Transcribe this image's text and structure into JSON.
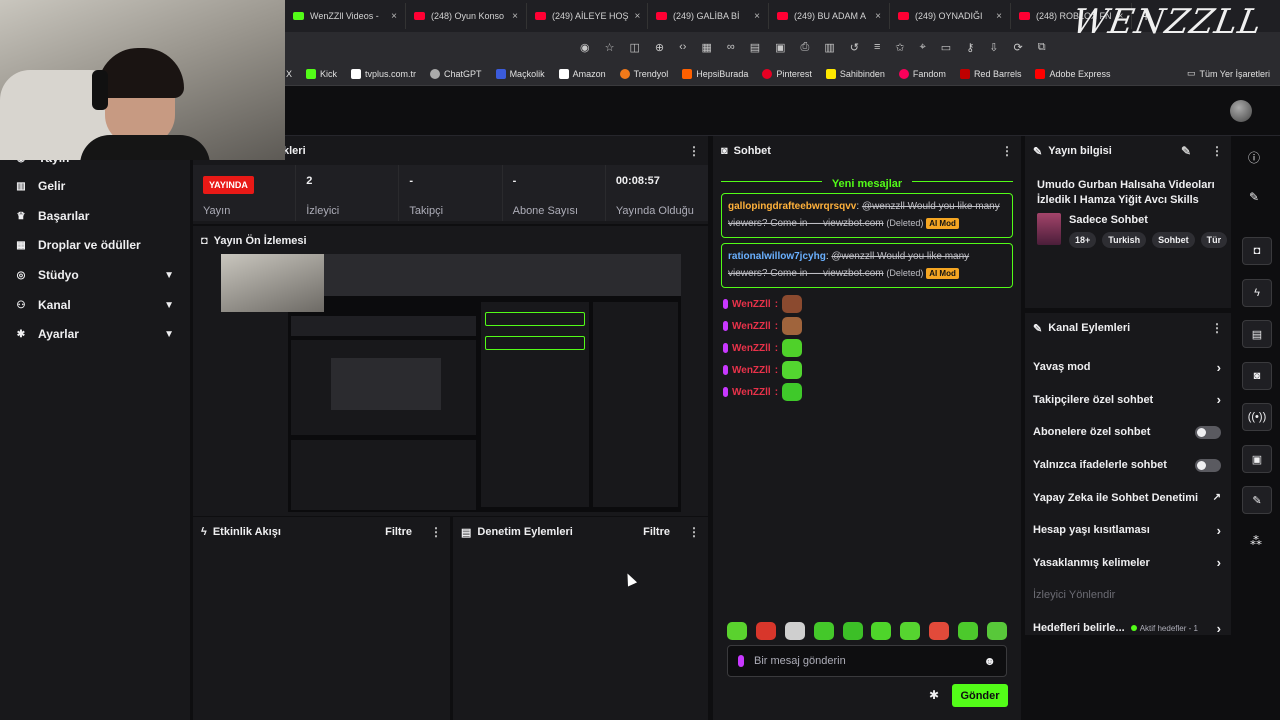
{
  "browser": {
    "tabs": [
      {
        "label": "WenZZll Videos -",
        "favicon": "kick-icon"
      },
      {
        "label": "(248) Oyun Konso",
        "favicon": "youtube-icon"
      },
      {
        "label": "(249) AİLEYE HOŞ",
        "favicon": "youtube-icon"
      },
      {
        "label": "(249) GALİBA Bİ",
        "favicon": "youtube-icon"
      },
      {
        "label": "(249) BU ADAM A",
        "favicon": "youtube-icon"
      },
      {
        "label": "(249) OYNADIĞI",
        "favicon": "youtube-icon"
      },
      {
        "label": "(248) ROBLOX FN",
        "favicon": "youtube-icon"
      }
    ],
    "bookmarks": [
      {
        "label": "X",
        "color": "#ffffff"
      },
      {
        "label": "Kick",
        "color": "#53fc18"
      },
      {
        "label": "tvplus.com.tr",
        "color": "#ffffff"
      },
      {
        "label": "ChatGPT",
        "color": "#cccccc"
      },
      {
        "label": "Maçkolik",
        "color": "#3b5bdb"
      },
      {
        "label": "Amazon",
        "color": "#ffffff"
      },
      {
        "label": "Trendyol",
        "color": "#f27a1a"
      },
      {
        "label": "HepsiBurada",
        "color": "#ff6000"
      },
      {
        "label": "Pinterest",
        "color": "#e60023"
      },
      {
        "label": "Sahibinden",
        "color": "#ffe800"
      },
      {
        "label": "Fandom",
        "color": "#fa005a"
      },
      {
        "label": "Red Barrels",
        "color": "#c00000"
      },
      {
        "label": "Adobe Express",
        "color": "#ff0000"
      }
    ],
    "all_bookmarks": "Tüm Yer İşaretleri"
  },
  "overlay": {
    "logo_text": "WENZZLL"
  },
  "sidebar": {
    "items": [
      {
        "label": "Yayın",
        "icon": "broadcast-icon"
      },
      {
        "label": "Gelir",
        "icon": "chart-icon"
      },
      {
        "label": "Başarılar",
        "icon": "trophy-icon"
      },
      {
        "label": "Droplar ve ödüller",
        "icon": "gift-icon"
      },
      {
        "label": "Stüdyo",
        "icon": "studio-icon"
      },
      {
        "label": "Kanal",
        "icon": "channel-icon"
      },
      {
        "label": "Ayarlar",
        "icon": "gear-icon"
      }
    ]
  },
  "stats_panel": {
    "title_partial": "kleri",
    "live_badge": "YAYINDA",
    "stats": [
      {
        "value": "",
        "label": "Yayın"
      },
      {
        "value": "2",
        "label": "İzleyici"
      },
      {
        "value": "-",
        "label": "Takipçi"
      },
      {
        "value": "-",
        "label": "Abone Sayısı"
      },
      {
        "value": "00:08:57",
        "label": "Yayında Olduğu"
      }
    ]
  },
  "preview": {
    "title": "Yayın Ön İzlemesi"
  },
  "activity": {
    "title": "Etkinlik Akışı",
    "filter": "Filtre"
  },
  "moderation": {
    "title": "Denetim Eylemleri",
    "filter": "Filtre"
  },
  "chat": {
    "title": "Sohbet",
    "new_messages": "Yeni mesajlar",
    "flagged": [
      {
        "user": "gallopingdrafteebwrqrsqvv",
        "text": "@wenzzll Would you like many viewers? Come in — viewzbot.com",
        "deleted": "(Deleted)",
        "badge": "AI Mod",
        "user_color": "#ffb13b"
      },
      {
        "user": "rationalwillow7jcyhg",
        "text": "@wenzzll Would you like many viewers? Come in — viewzbot.com",
        "deleted": "(Deleted)",
        "badge": "AI Mod",
        "user_color": "#6ab0ff"
      }
    ],
    "messages": [
      {
        "user": "WenZZll",
        "emote": "#8b4a2f"
      },
      {
        "user": "WenZZll",
        "emote": "#a0643c"
      },
      {
        "user": "WenZZll",
        "emote": "#4fd12a"
      },
      {
        "user": "WenZZll",
        "emote": "#53d630"
      },
      {
        "user": "WenZZll",
        "emote": "#3fc92a"
      }
    ],
    "emote_bar": [
      "#5ad22e",
      "#d8362b",
      "#cfcfcf",
      "#44c82a",
      "#3cbf27",
      "#4ed52a",
      "#56d430",
      "#e24a3a",
      "#4cc92c",
      "#58c83a"
    ],
    "input_placeholder": "Bir mesaj gönderin",
    "send_label": "Gönder"
  },
  "stream_info": {
    "title": "Yayın bilgisi",
    "stream_title": "Umudo Gurban Halısaha Videoları İzledik l Hamza Yiğit Avcı Skills",
    "category": "Sadece Sohbet",
    "tags": [
      "18+",
      "Turkish",
      "Sohbet",
      "Tür"
    ]
  },
  "channel_actions": {
    "title": "Kanal Eylemleri",
    "rows": [
      {
        "label": "Yavaş mod",
        "control": "chevron"
      },
      {
        "label": "Takipçilere özel sohbet",
        "control": "chevron"
      },
      {
        "label": "Abonelere özel sohbet",
        "control": "toggle"
      },
      {
        "label": "Yalnızca ifadelerle sohbet",
        "control": "toggle"
      },
      {
        "label": "Yapay Zeka ile Sohbet Denetimi",
        "control": "external"
      },
      {
        "label": "Hesap yaşı kısıtlaması",
        "control": "chevron"
      },
      {
        "label": "Yasaklanmış kelimeler",
        "control": "chevron"
      }
    ],
    "viewer_redirect": "İzleyici Yönlendir",
    "goals_label": "Hedefleri belirle...",
    "goals_status": "Aktif hedefler - 1"
  },
  "colors": {
    "accent": "#53fc18",
    "live": "#e91916",
    "panel": "#18181b"
  }
}
